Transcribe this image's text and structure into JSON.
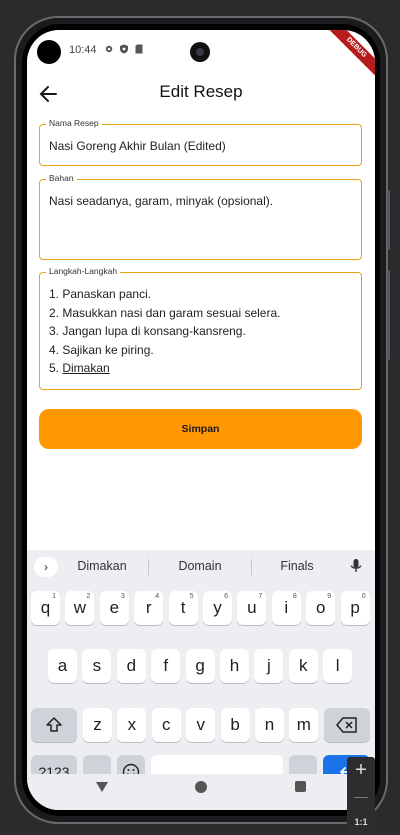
{
  "status_bar": {
    "time": "10:44",
    "icons": [
      "gear-icon",
      "shield-icon",
      "sd-card-icon"
    ],
    "debug_banner": "DEBUG"
  },
  "appbar": {
    "title": "Edit Resep",
    "back_icon": "arrow-left-icon"
  },
  "form": {
    "name": {
      "label": "Nama Resep",
      "value": "Nasi Goreng Akhir Bulan (Edited)"
    },
    "ingredients": {
      "label": "Bahan",
      "value": "Nasi seadanya, garam, minyak (opsional)."
    },
    "steps": {
      "label": "Langkah-Langkah",
      "lines": [
        "1. Panaskan panci.",
        "2. Masukkan nasi dan garam sesuai selera.",
        "3. Jangan lupa di konsang-kansreng.",
        "4. Sajikan ke piring."
      ],
      "last_prefix": "5. ",
      "last_word": "Dimakan"
    },
    "save_label": "Simpan"
  },
  "keyboard": {
    "expand_icon": "chevron-right-icon",
    "suggestions": [
      "Dimakan",
      "Domain",
      "Finals"
    ],
    "mic_icon": "mic-icon",
    "row1": [
      {
        "k": "q",
        "h": "1"
      },
      {
        "k": "w",
        "h": "2"
      },
      {
        "k": "e",
        "h": "3"
      },
      {
        "k": "r",
        "h": "4"
      },
      {
        "k": "t",
        "h": "5"
      },
      {
        "k": "y",
        "h": "6"
      },
      {
        "k": "u",
        "h": "7"
      },
      {
        "k": "i",
        "h": "8"
      },
      {
        "k": "o",
        "h": "9"
      },
      {
        "k": "p",
        "h": "0"
      }
    ],
    "row2": [
      "a",
      "s",
      "d",
      "f",
      "g",
      "h",
      "j",
      "k",
      "l"
    ],
    "row3": [
      "z",
      "x",
      "c",
      "v",
      "b",
      "n",
      "m"
    ],
    "shift_icon": "shift-icon",
    "backspace_icon": "backspace-icon",
    "symbols_label": "?123",
    "comma_label": ",",
    "emoji_icon": "emoji-icon",
    "period_label": ".",
    "enter_icon": "enter-icon"
  },
  "navbar": {
    "back_icon": "nav-back-icon",
    "home_icon": "nav-home-icon",
    "recents_icon": "nav-recents-icon"
  },
  "emulator": {
    "zoom_in": "+",
    "ratio": "1:1"
  }
}
